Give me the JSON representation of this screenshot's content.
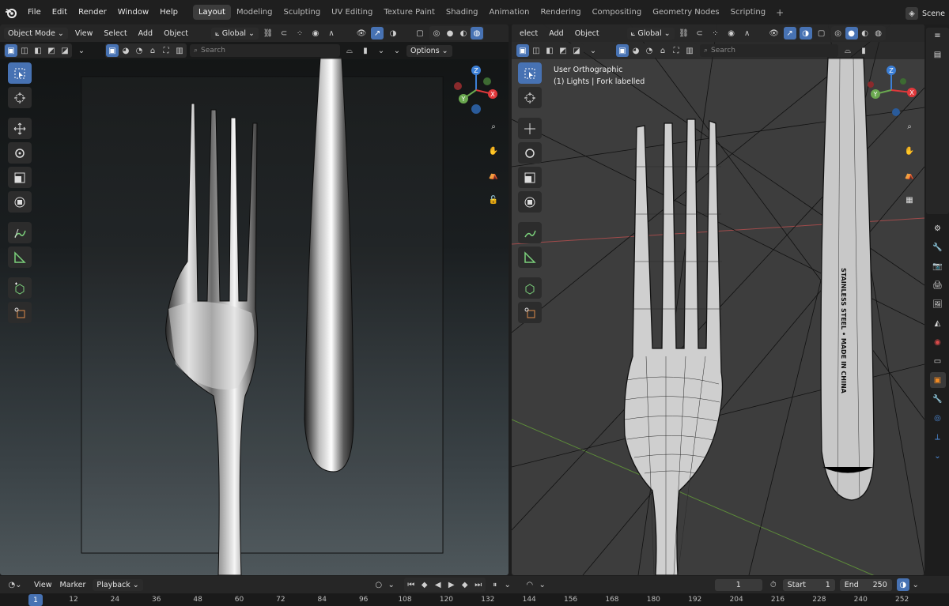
{
  "menu": [
    "File",
    "Edit",
    "Render",
    "Window",
    "Help"
  ],
  "workspaces": [
    "Layout",
    "Modeling",
    "Sculpting",
    "UV Editing",
    "Texture Paint",
    "Shading",
    "Animation",
    "Rendering",
    "Compositing",
    "Geometry Nodes",
    "Scripting"
  ],
  "active_workspace": "Layout",
  "scene_label": "Scene",
  "left_viewport": {
    "mode": "Object Mode",
    "menus": [
      "View",
      "Select",
      "Add",
      "Object"
    ],
    "orientation": "Global",
    "options_label": "Options",
    "search_placeholder": "Search"
  },
  "right_viewport": {
    "menus": [
      "elect",
      "Add",
      "Object"
    ],
    "orientation": "Global",
    "search_placeholder": "Search",
    "view_name": "User Orthographic",
    "view_info": "(1) Lights | Fork labelled",
    "engraving": "STAINLESS STEEL • MADE IN CHINA"
  },
  "timeline": {
    "menus": [
      "View",
      "Marker"
    ],
    "playback_label": "Playback",
    "current_frame": "1",
    "start_label": "Start",
    "start_value": "1",
    "end_label": "End",
    "end_value": "250",
    "ruler_ticks": [
      "12",
      "24",
      "36",
      "48",
      "60",
      "72",
      "84",
      "96",
      "108",
      "120",
      "132",
      "144",
      "156",
      "168",
      "180",
      "192",
      "204",
      "216",
      "228",
      "240",
      "252"
    ],
    "cursor_label": "1"
  },
  "colors": {
    "accent": "#4772b3",
    "x_axis": "#e0383b",
    "y_axis": "#6aa84f",
    "z_axis": "#3c7fd6"
  }
}
